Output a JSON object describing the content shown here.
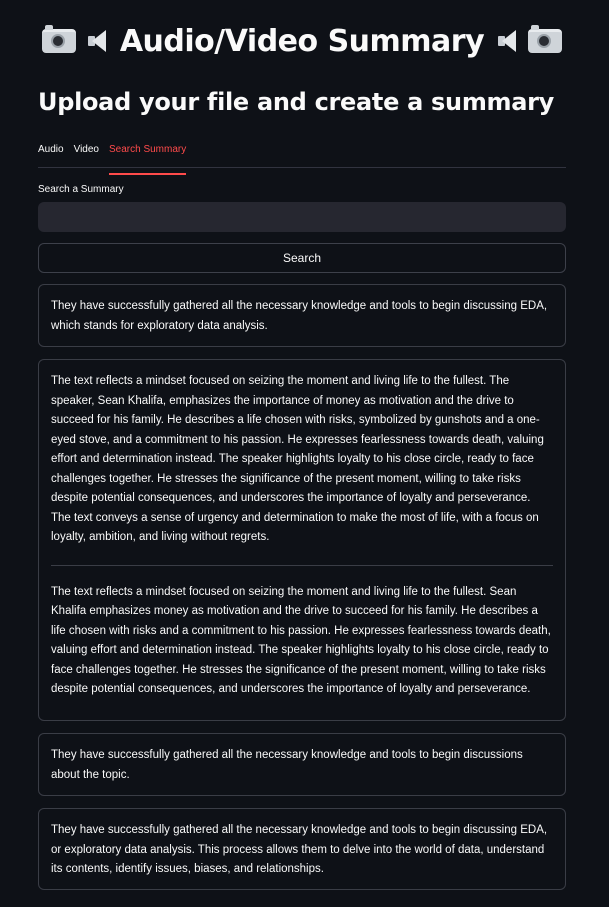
{
  "header": {
    "title": "Audio/Video Summary",
    "subtitle": "Upload your file and create a summary",
    "icons": [
      "camera-icon",
      "speaker-icon",
      "speaker-icon",
      "camera-icon"
    ]
  },
  "tabs": [
    {
      "label": "Audio",
      "active": false
    },
    {
      "label": "Video",
      "active": false
    },
    {
      "label": "Search Summary",
      "active": true
    }
  ],
  "search": {
    "label": "Search a Summary",
    "value": "",
    "placeholder": "",
    "button_label": "Search"
  },
  "results": [
    {
      "paragraphs": [
        "They have successfully gathered all the necessary knowledge and tools to begin discussing EDA, which stands for exploratory data analysis."
      ]
    },
    {
      "paragraphs": [
        "The text reflects a mindset focused on seizing the moment and living life to the fullest. The speaker, Sean Khalifa, emphasizes the importance of money as motivation and the drive to succeed for his family. He describes a life chosen with risks, symbolized by gunshots and a one-eyed stove, and a commitment to his passion. He expresses fearlessness towards death, valuing effort and determination instead. The speaker highlights loyalty to his close circle, ready to face challenges together. He stresses the significance of the present moment, willing to take risks despite potential consequences, and underscores the importance of loyalty and perseverance. The text conveys a sense of urgency and determination to make the most of life, with a focus on loyalty, ambition, and living without regrets.",
        "The text reflects a mindset focused on seizing the moment and living life to the fullest. Sean Khalifa emphasizes money as motivation and the drive to succeed for his family. He describes a life chosen with risks and a commitment to his passion. He expresses fearlessness towards death, valuing effort and determination instead. The speaker highlights loyalty to his close circle, ready to face challenges together. He stresses the significance of the present moment, willing to take risks despite potential consequences, and underscores the importance of loyalty and perseverance."
      ]
    },
    {
      "paragraphs": [
        "They have successfully gathered all the necessary knowledge and tools to begin discussions about the topic."
      ]
    },
    {
      "paragraphs": [
        "They have successfully gathered all the necessary knowledge and tools to begin discussing EDA, or exploratory data analysis. This process allows them to delve into the world of data, understand its contents, identify issues, biases, and relationships."
      ]
    }
  ]
}
